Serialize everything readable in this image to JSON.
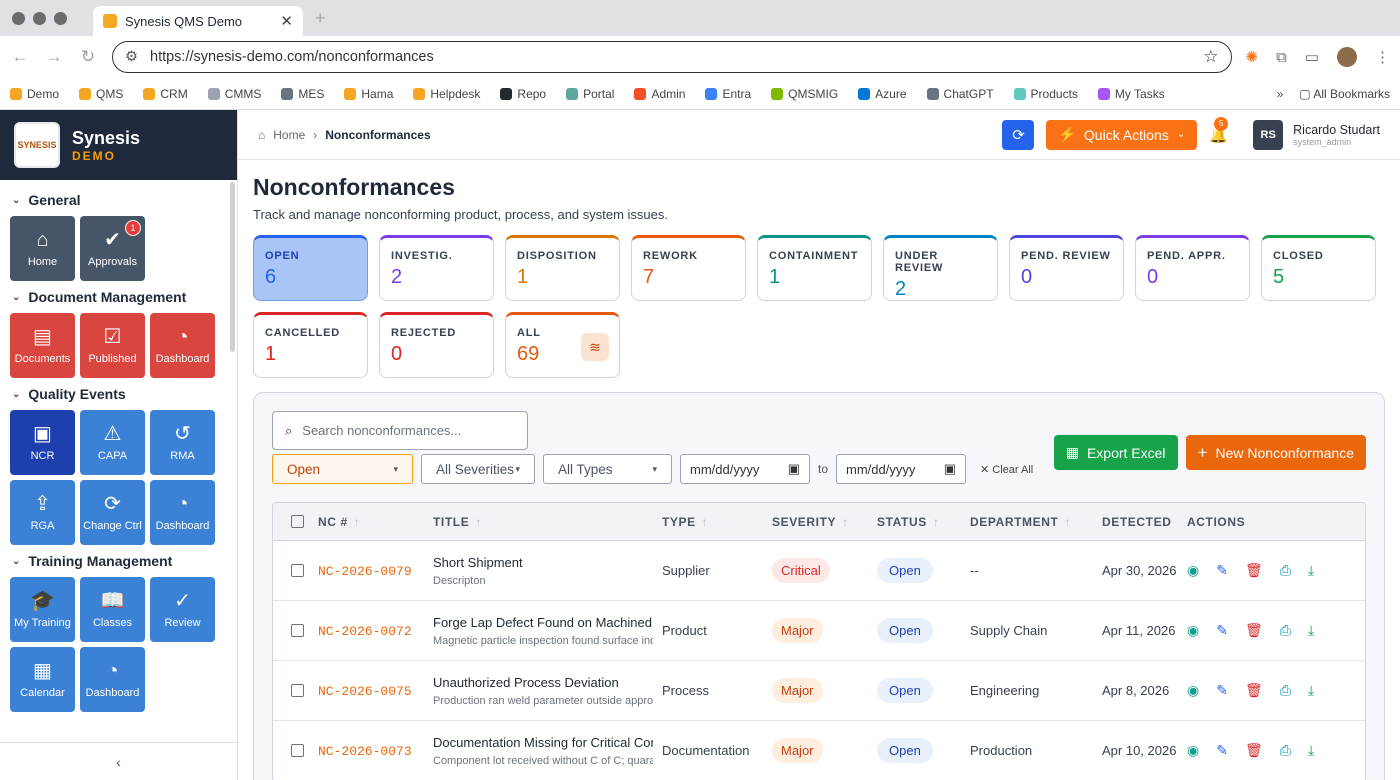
{
  "browser": {
    "tab_title": "Synesis QMS Demo",
    "url_host": "https://synesis-demo.com",
    "url_path": "/nonconformances",
    "bookmarks": [
      {
        "label": "Demo",
        "color": "#f5a623"
      },
      {
        "label": "QMS",
        "color": "#f5a623"
      },
      {
        "label": "CRM",
        "color": "#f5a623"
      },
      {
        "label": "CMMS",
        "color": "#9ca3af"
      },
      {
        "label": "MES",
        "color": "#6b7280"
      },
      {
        "label": "Hama",
        "color": "#f5a623"
      },
      {
        "label": "Helpdesk",
        "color": "#f5a623"
      },
      {
        "label": "Repo",
        "color": "#24292e"
      },
      {
        "label": "Portal",
        "color": "#5fa8a0"
      },
      {
        "label": "Admin",
        "color": "#f25022"
      },
      {
        "label": "Entra",
        "color": "#3b82f6"
      },
      {
        "label": "QMSMIG",
        "color": "#7fba00"
      },
      {
        "label": "Azure",
        "color": "#0078d4"
      },
      {
        "label": "ChatGPT",
        "color": "#6b7280"
      },
      {
        "label": "Products",
        "color": "#5fc8c0"
      },
      {
        "label": "My Tasks",
        "color": "#a855f7"
      }
    ],
    "all_bookmarks": "All Bookmarks"
  },
  "brand": {
    "name": "Synesis",
    "sub": "DEMO",
    "logo_text": "SYNESIS"
  },
  "sidebar": {
    "sections": [
      {
        "title": "General",
        "tiles": [
          {
            "label": "Home",
            "icon": "⌂",
            "color": "slate"
          },
          {
            "label": "Approvals",
            "icon": "✔",
            "color": "slate",
            "badge": "1"
          }
        ]
      },
      {
        "title": "Document Management",
        "tiles": [
          {
            "label": "Documents",
            "icon": "▤",
            "color": "red"
          },
          {
            "label": "Published",
            "icon": "☑",
            "color": "red"
          },
          {
            "label": "Dashboard",
            "icon": "◔",
            "color": "red"
          }
        ]
      },
      {
        "title": "Quality Events",
        "tiles": [
          {
            "label": "NCR",
            "icon": "▣",
            "color": "navy"
          },
          {
            "label": "CAPA",
            "icon": "⚠",
            "color": "blue"
          },
          {
            "label": "RMA",
            "icon": "↺",
            "color": "blue"
          },
          {
            "label": "RGA",
            "icon": "⇪",
            "color": "blue"
          },
          {
            "label": "Change Ctrl",
            "icon": "⟳",
            "color": "blue"
          },
          {
            "label": "Dashboard",
            "icon": "◔",
            "color": "blue"
          }
        ]
      },
      {
        "title": "Training Management",
        "tiles": [
          {
            "label": "My Training",
            "icon": "🎓",
            "color": "blue"
          },
          {
            "label": "Classes",
            "icon": "📖",
            "color": "blue"
          },
          {
            "label": "Review",
            "icon": "✓",
            "color": "blue"
          },
          {
            "label": "Calendar",
            "icon": "▦",
            "color": "blue"
          },
          {
            "label": "Dashboard",
            "icon": "◔",
            "color": "blue"
          }
        ]
      }
    ],
    "collapse": "‹"
  },
  "topbar": {
    "crumb_home": "Home",
    "crumb_current": "Nonconformances",
    "quick_actions": "Quick Actions",
    "notif_count": "5",
    "user_initials": "RS",
    "user_name": "Ricardo Studart",
    "user_role": "system_admin"
  },
  "page": {
    "title": "Nonconformances",
    "subtitle": "Track and manage nonconforming product, process, and system issues."
  },
  "status_cards": [
    {
      "label": "OPEN",
      "value": "6",
      "color": "#2563eb",
      "active": true
    },
    {
      "label": "INVESTIG.",
      "value": "2",
      "color": "#7c3aed"
    },
    {
      "label": "DISPOSITION",
      "value": "1",
      "color": "#d97706"
    },
    {
      "label": "REWORK",
      "value": "7",
      "color": "#ea580c"
    },
    {
      "label": "CONTAINMENT",
      "value": "1",
      "color": "#0d9488"
    },
    {
      "label": "UNDER REVIEW",
      "value": "2",
      "color": "#0284c7"
    },
    {
      "label": "PEND. REVIEW",
      "value": "0",
      "color": "#4f46e5"
    },
    {
      "label": "PEND. APPR.",
      "value": "0",
      "color": "#7c3aed"
    },
    {
      "label": "CLOSED",
      "value": "5",
      "color": "#16a34a"
    },
    {
      "label": "CANCELLED",
      "value": "1",
      "color": "#dc2626"
    },
    {
      "label": "REJECTED",
      "value": "0",
      "color": "#dc2626"
    },
    {
      "label": "ALL",
      "value": "69",
      "color": "#ea580c",
      "stack": true
    }
  ],
  "toolbar": {
    "search_placeholder": "Search nonconformances...",
    "export": "Export Excel",
    "new": "New Nonconformance",
    "status_filter": "Open",
    "severity_filter": "All Severities",
    "type_filter": "All Types",
    "date_placeholder": "mm/dd/yyyy",
    "to": "to",
    "clear": "✕ Clear All"
  },
  "table": {
    "headers": [
      "NC #",
      "TITLE",
      "TYPE",
      "SEVERITY",
      "STATUS",
      "DEPARTMENT",
      "DETECTED",
      "ACTIONS"
    ],
    "rows": [
      {
        "id": "NC-2026-0079",
        "title": "Short Shipment",
        "desc": "Descripton",
        "type": "Supplier",
        "severity": "Critical",
        "status": "Open",
        "dept": "--",
        "detected": "Apr 30, 2026"
      },
      {
        "id": "NC-2026-0072",
        "title": "Forge Lap Defect Found on Machined Shaft",
        "desc": "Magnetic particle inspection found surface indication",
        "type": "Product",
        "severity": "Major",
        "status": "Open",
        "dept": "Supply Chain",
        "detected": "Apr 11, 2026"
      },
      {
        "id": "NC-2026-0075",
        "title": "Unauthorized Process Deviation",
        "desc": "Production ran weld parameter outside approved range",
        "type": "Process",
        "severity": "Major",
        "status": "Open",
        "dept": "Engineering",
        "detected": "Apr 8, 2026"
      },
      {
        "id": "NC-2026-0073",
        "title": "Documentation Missing for Critical Component",
        "desc": "Component lot received without C of C; quarantined",
        "type": "Documentation",
        "severity": "Major",
        "status": "Open",
        "dept": "Production",
        "detected": "Apr 10, 2026"
      }
    ]
  }
}
